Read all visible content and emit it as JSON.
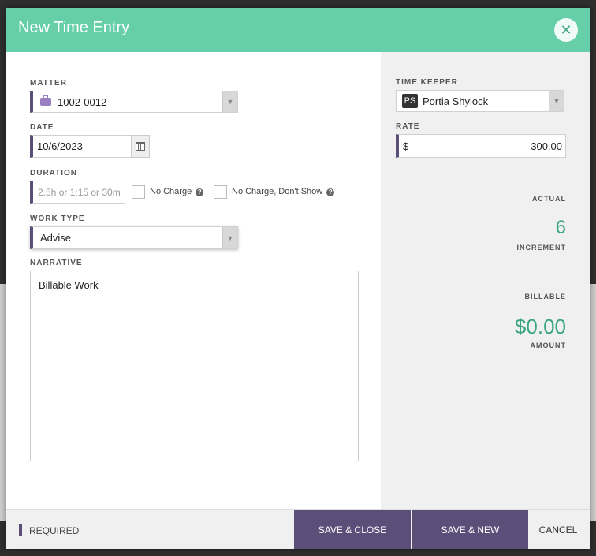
{
  "dialog": {
    "title": "New Time Entry",
    "close_icon": "close-icon",
    "accent_color": "#66cfa9",
    "required_color": "#5b4e78"
  },
  "form": {
    "matter": {
      "label": "MATTER",
      "value": "1002-0012"
    },
    "date": {
      "label": "DATE",
      "value": "10/6/2023"
    },
    "duration": {
      "label": "DURATION",
      "placeholder": "2.5h or 1:15 or 30m",
      "no_charge_label": "No Charge",
      "no_charge_dont_show_label": "No Charge, Don't Show",
      "no_charge_checked": false,
      "no_charge_dont_show_checked": false
    },
    "work_type": {
      "label": "WORK TYPE",
      "value": "Advise"
    },
    "narrative": {
      "label": "NARRATIVE",
      "value": "Billable Work"
    }
  },
  "side": {
    "time_keeper": {
      "label": "TIME KEEPER",
      "initials": "PS",
      "value": "Portia Shylock"
    },
    "rate": {
      "label": "RATE",
      "currency": "$",
      "value": "300.00"
    },
    "actual_label": "ACTUAL",
    "increment_value": "6",
    "increment_label": "INCREMENT",
    "billable_label": "BILLABLE",
    "amount_value": "$0.00",
    "amount_label": "AMOUNT"
  },
  "footer": {
    "required_label": "REQUIRED",
    "save_close_label": "SAVE & CLOSE",
    "save_new_label": "SAVE & NEW",
    "cancel_label": "CANCEL"
  }
}
